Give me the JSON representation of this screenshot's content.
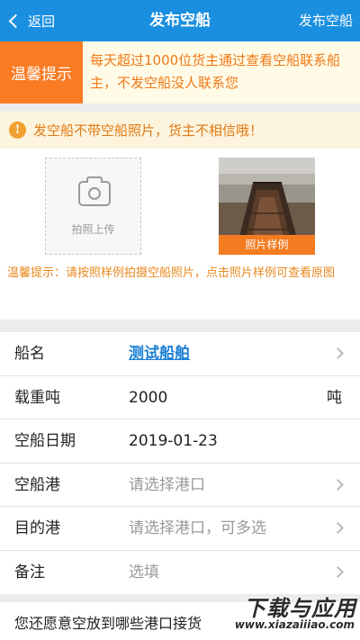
{
  "nav": {
    "back_label": "返回",
    "title": "发布空船",
    "action_label": "发布空船"
  },
  "tip": {
    "tag": "温馨提示",
    "text": "每天超过1000位货主通过查看空船联系船主，不发空船没人联系您"
  },
  "warning": {
    "icon": "!",
    "text": "发空船不带空船照片，货主不相信哦！"
  },
  "photos": {
    "upload_label": "拍照上传",
    "sample_label": "照片样例",
    "note": "温馨提示：请按照样例拍摄空船照片，点击照片样例可查看原图"
  },
  "form": {
    "ship_name_label": "船名",
    "ship_name_value": "测试船舶",
    "tonnage_label": "载重吨",
    "tonnage_value": "2000",
    "tonnage_unit": "吨",
    "date_label": "空船日期",
    "date_value": "2019-01-23",
    "port_label": "空船港",
    "port_placeholder": "请选择港口",
    "dest_label": "目的港",
    "dest_placeholder": "请选择港口，可多选",
    "remark_label": "备注",
    "remark_placeholder": "选填"
  },
  "bottom": {
    "text": "您还愿意空放到哪些港口接货"
  },
  "watermark": {
    "main": "下载与应用",
    "sub": "www.xiazaiiiao.com"
  },
  "colors": {
    "nav_blue": "#1a8fe0",
    "tip_orange": "#f97b24",
    "link_blue": "#1a7fd4"
  }
}
